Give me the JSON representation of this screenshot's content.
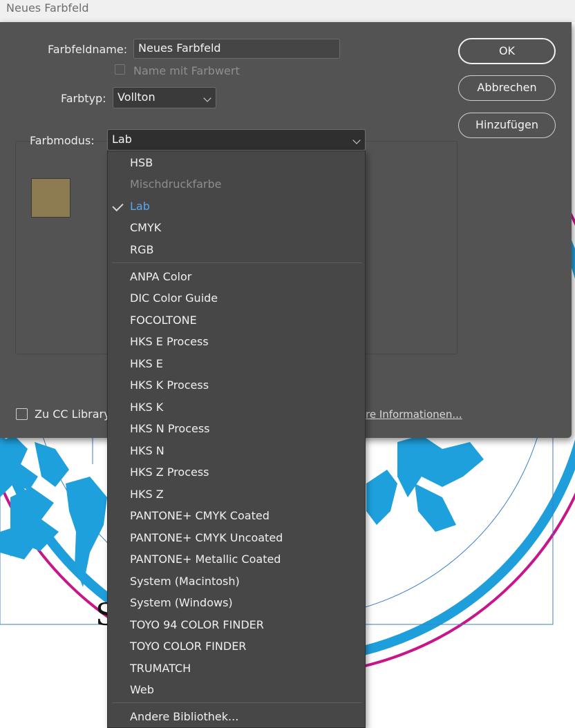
{
  "window": {
    "title": "Neues Farbfeld"
  },
  "dialog": {
    "name_label": "Farbfeldname:",
    "name_value": "Neues Farbfeld",
    "name_with_value_label": "Name mit Farbwert",
    "name_with_value_checked": false,
    "type_label": "Farbtyp:",
    "type_value": "Vollton",
    "mode_label": "Farbmodus:",
    "mode_value": "Lab",
    "swatch_color": "#8d7b52",
    "add_to_cc_label": "Zu CC Library",
    "add_to_cc_checked": false,
    "more_info_link": "re Informationen..."
  },
  "buttons": {
    "ok": "OK",
    "cancel": "Abbrechen",
    "add": "Hinzufügen"
  },
  "menu": {
    "group1": [
      {
        "label": "HSB",
        "state": "normal"
      },
      {
        "label": "Mischdruckfarbe",
        "state": "disabled"
      },
      {
        "label": "Lab",
        "state": "selected"
      },
      {
        "label": "CMYK",
        "state": "normal"
      },
      {
        "label": "RGB",
        "state": "normal"
      }
    ],
    "group2": [
      "ANPA Color",
      "DIC Color Guide",
      "FOCOLTONE",
      "HKS E Process",
      "HKS E",
      "HKS K Process",
      "HKS K",
      "HKS N Process",
      "HKS N",
      "HKS Z Process",
      "HKS Z",
      "PANTONE+ CMYK Coated",
      "PANTONE+ CMYK Uncoated",
      "PANTONE+ Metallic Coated",
      "System (Macintosh)",
      "System (Windows)",
      "TOYO 94 COLOR FINDER",
      "TOYO COLOR FINDER",
      "TRUMATCH",
      "Web"
    ],
    "other_library": "Andere Bibliothek..."
  },
  "colors": {
    "dialog_bg": "#535353",
    "menu_bg": "#474747",
    "selected_text": "#5aa6ee",
    "doc_cyan": "#1e9fdc",
    "doc_magenta": "#c8168a"
  }
}
